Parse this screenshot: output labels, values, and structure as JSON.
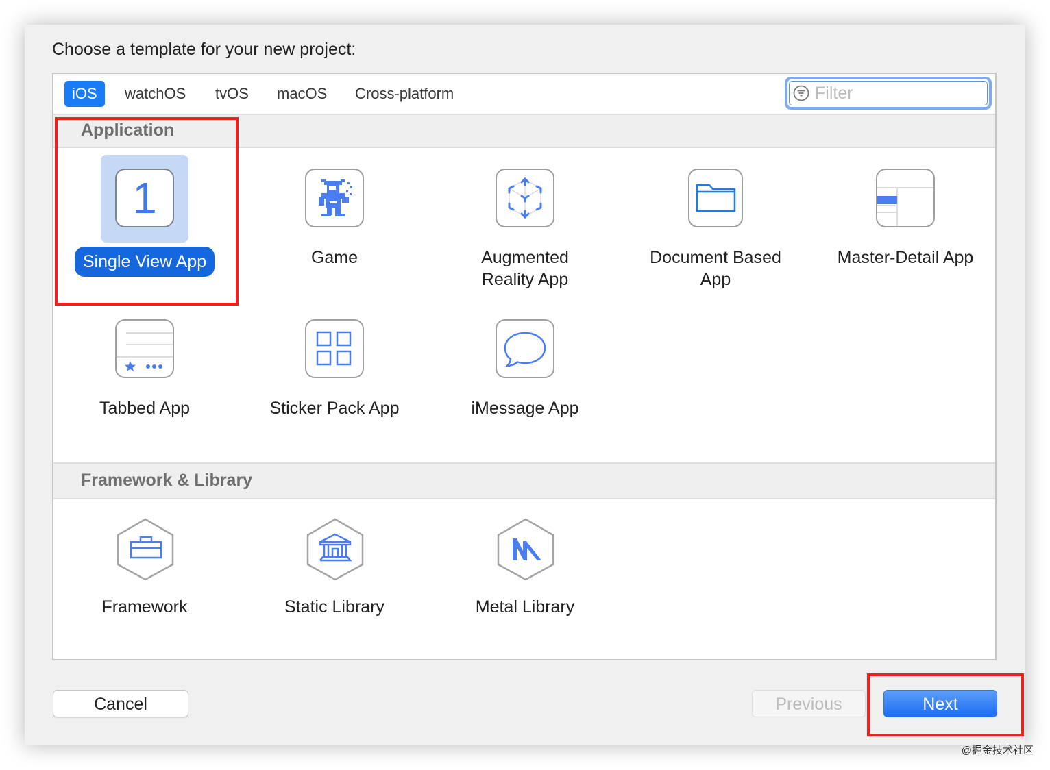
{
  "dialog": {
    "title": "Choose a template for your new project:"
  },
  "platform_tabs": [
    {
      "label": "iOS",
      "active": true
    },
    {
      "label": "watchOS",
      "active": false
    },
    {
      "label": "tvOS",
      "active": false
    },
    {
      "label": "macOS",
      "active": false
    },
    {
      "label": "Cross-platform",
      "active": false
    }
  ],
  "filter": {
    "placeholder": "Filter",
    "value": "",
    "icon": "filter-icon"
  },
  "sections": [
    {
      "title": "Application",
      "templates": [
        {
          "label": "Single View App",
          "icon": "single-view-icon",
          "selected": true
        },
        {
          "label": "Game",
          "icon": "game-sprite-icon",
          "selected": false
        },
        {
          "label": "Augmented Reality App",
          "line1": "Augmented",
          "line2": "Reality App",
          "icon": "ar-cube-icon",
          "selected": false
        },
        {
          "label": "Document Based App",
          "line1": "Document Based",
          "line2": "App",
          "icon": "folder-icon",
          "selected": false
        },
        {
          "label": "Master-Detail App",
          "icon": "master-detail-icon",
          "selected": false
        },
        {
          "label": "Tabbed App",
          "icon": "tab-bar-icon",
          "selected": false
        },
        {
          "label": "Sticker Pack App",
          "icon": "sticker-grid-icon",
          "selected": false
        },
        {
          "label": "iMessage App",
          "icon": "message-bubble-icon",
          "selected": false
        }
      ]
    },
    {
      "title": "Framework & Library",
      "templates": [
        {
          "label": "Framework",
          "icon": "toolbox-icon"
        },
        {
          "label": "Static Library",
          "icon": "library-building-icon"
        },
        {
          "label": "Metal Library",
          "icon": "metal-icon"
        }
      ]
    }
  ],
  "single_view_digit": "1",
  "buttons": {
    "cancel": "Cancel",
    "previous": "Previous",
    "next": "Next",
    "previous_enabled": false
  },
  "colors": {
    "accent": "#1a7cf5",
    "icon_blue": "#4a7ef0",
    "annotation_red": "#f0201c"
  },
  "watermark": "@掘金技术社区"
}
